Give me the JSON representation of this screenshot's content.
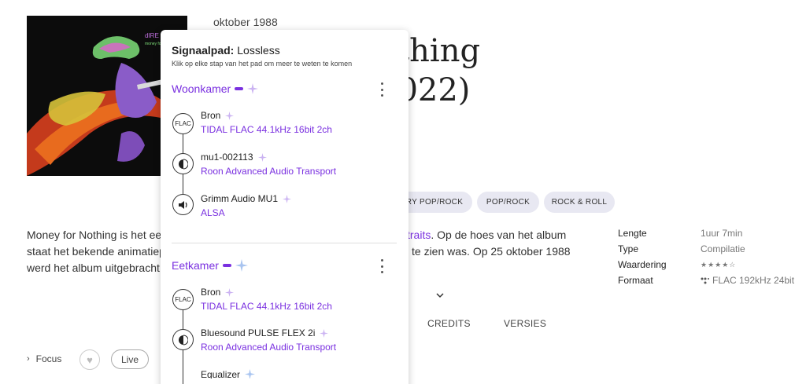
{
  "album": {
    "date": "oktober 1988",
    "title_line1": "othing",
    "title_line2": "2022)",
    "cover_text_top": "dIRE STRAITS",
    "cover_text_bottom": "money for nothing"
  },
  "genres": [
    "ARY POP/ROCK",
    "POP/ROCK",
    "ROCK & ROLL"
  ],
  "description": {
    "line1": "Money for Nothing is het ee",
    "line2": "staat het bekende animatiep",
    "line3": "werd het album uitgebracht",
    "line1_link": "traits",
    "line1_right": ". Op de hoes van het album",
    "line2_right": "te zien was. Op 25 oktober 1988"
  },
  "meta": [
    {
      "key": "Lengte",
      "value": "1uur 7min"
    },
    {
      "key": "Type",
      "value": "Compilatie"
    },
    {
      "key": "Waardering",
      "value": "★★★★☆"
    },
    {
      "key": "Formaat",
      "value": "FLAC 192kHz 24bit"
    }
  ],
  "tabs": [
    "CREDITS",
    "VERSIES"
  ],
  "actions": {
    "focus": "Focus",
    "live": "Live"
  },
  "signal_path": {
    "title_bold": "Signaalpad:",
    "quality": "Lossless",
    "subtitle": "Klik op elke stap van het pad om meer te weten te komen",
    "zones": [
      {
        "name": "Woonkamer",
        "steps": [
          {
            "icon": "flac-icon",
            "icon_text": "FLAC",
            "name": "Bron",
            "detail": "TIDAL FLAC 44.1kHz 16bit 2ch"
          },
          {
            "icon": "dsp-icon",
            "name": "mu1-002113",
            "detail": "Roon Advanced Audio Transport"
          },
          {
            "icon": "speaker-icon",
            "name": "Grimm Audio MU1",
            "detail": "ALSA"
          }
        ]
      },
      {
        "name": "Eetkamer",
        "steps": [
          {
            "icon": "flac-icon",
            "icon_text": "FLAC",
            "name": "Bron",
            "detail": "TIDAL FLAC 44.1kHz 16bit 2ch"
          },
          {
            "icon": "dsp-icon",
            "name": "Bluesound PULSE FLEX 2i",
            "detail": "Roon Advanced Audio Transport"
          },
          {
            "icon": "equalizer-icon",
            "name": "Equalizer",
            "detail": ""
          }
        ]
      }
    ]
  },
  "colors": {
    "accent": "#7a30e0",
    "chip_bg": "#e8e8f2"
  }
}
